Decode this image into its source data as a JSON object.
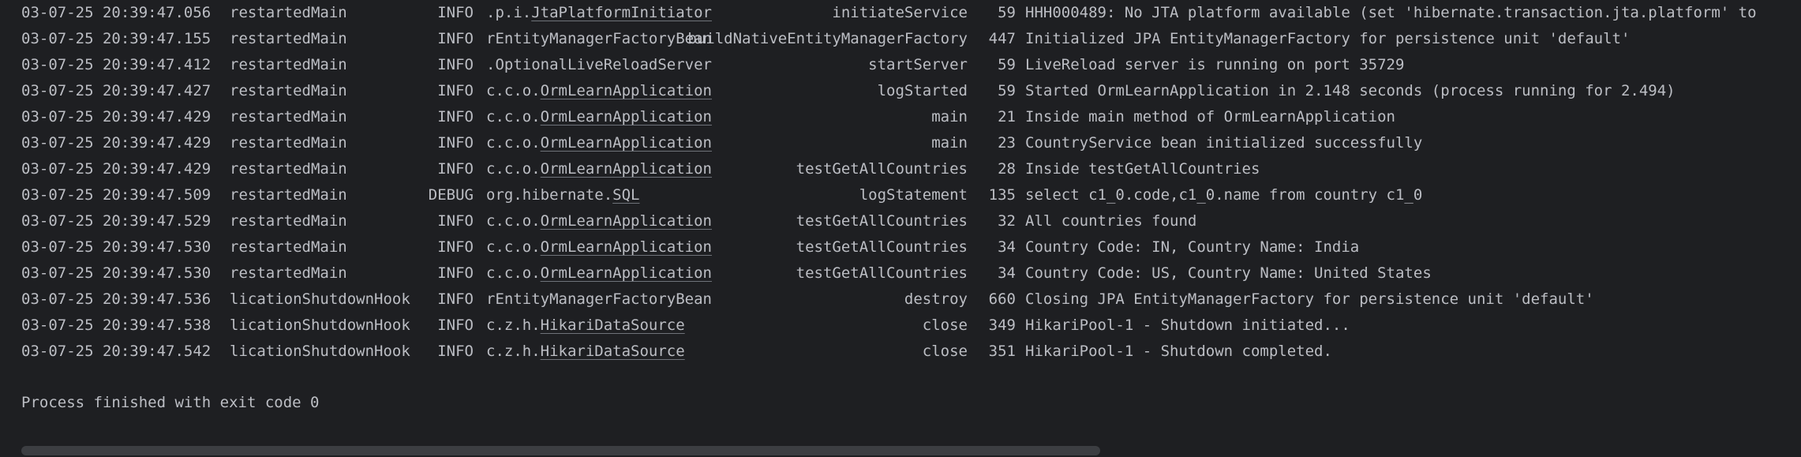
{
  "console": {
    "rows": [
      {
        "ts": "03-07-25 20:39:47.056",
        "thread": "restartedMain",
        "level": "INFO",
        "logger_prefix": ".p.i.",
        "logger_link": "JtaPlatformInitiator",
        "method": "initiateService",
        "line": "59",
        "message": "HHH000489: No JTA platform available (set 'hibernate.transaction.jta.platform' to"
      },
      {
        "ts": "03-07-25 20:39:47.155",
        "thread": "restartedMain",
        "level": "INFO",
        "logger_prefix": "rEntityManagerFactoryBean",
        "logger_link": "",
        "method": "buildNativeEntityManagerFactory",
        "line": "447",
        "message": "Initialized JPA EntityManagerFactory for persistence unit 'default'"
      },
      {
        "ts": "03-07-25 20:39:47.412",
        "thread": "restartedMain",
        "level": "INFO",
        "logger_prefix": ".OptionalLiveReloadServer",
        "logger_link": "",
        "method": "startServer",
        "line": "59",
        "message": "LiveReload server is running on port 35729"
      },
      {
        "ts": "03-07-25 20:39:47.427",
        "thread": "restartedMain",
        "level": "INFO",
        "logger_prefix": "c.c.o.",
        "logger_link": "OrmLearnApplication",
        "method": "logStarted",
        "line": "59",
        "message": "Started OrmLearnApplication in 2.148 seconds (process running for 2.494)"
      },
      {
        "ts": "03-07-25 20:39:47.429",
        "thread": "restartedMain",
        "level": "INFO",
        "logger_prefix": "c.c.o.",
        "logger_link": "OrmLearnApplication",
        "method": "main",
        "line": "21",
        "message": "Inside main method of OrmLearnApplication"
      },
      {
        "ts": "03-07-25 20:39:47.429",
        "thread": "restartedMain",
        "level": "INFO",
        "logger_prefix": "c.c.o.",
        "logger_link": "OrmLearnApplication",
        "method": "main",
        "line": "23",
        "message": "CountryService bean initialized successfully"
      },
      {
        "ts": "03-07-25 20:39:47.429",
        "thread": "restartedMain",
        "level": "INFO",
        "logger_prefix": "c.c.o.",
        "logger_link": "OrmLearnApplication",
        "method": "testGetAllCountries",
        "line": "28",
        "message": "Inside testGetAllCountries"
      },
      {
        "ts": "03-07-25 20:39:47.509",
        "thread": "restartedMain",
        "level": "DEBUG",
        "logger_prefix": "org.hibernate.",
        "logger_link": "SQL",
        "method": "logStatement",
        "line": "135",
        "message": "select c1_0.code,c1_0.name from country c1_0"
      },
      {
        "ts": "03-07-25 20:39:47.529",
        "thread": "restartedMain",
        "level": "INFO",
        "logger_prefix": "c.c.o.",
        "logger_link": "OrmLearnApplication",
        "method": "testGetAllCountries",
        "line": "32",
        "message": "All countries found"
      },
      {
        "ts": "03-07-25 20:39:47.530",
        "thread": "restartedMain",
        "level": "INFO",
        "logger_prefix": "c.c.o.",
        "logger_link": "OrmLearnApplication",
        "method": "testGetAllCountries",
        "line": "34",
        "message": "Country Code: IN, Country Name: India"
      },
      {
        "ts": "03-07-25 20:39:47.530",
        "thread": "restartedMain",
        "level": "INFO",
        "logger_prefix": "c.c.o.",
        "logger_link": "OrmLearnApplication",
        "method": "testGetAllCountries",
        "line": "34",
        "message": "Country Code: US, Country Name: United States"
      },
      {
        "ts": "03-07-25 20:39:47.536",
        "thread": "licationShutdownHook",
        "level": "INFO",
        "logger_prefix": "rEntityManagerFactoryBean",
        "logger_link": "",
        "method": "destroy",
        "line": "660",
        "message": "Closing JPA EntityManagerFactory for persistence unit 'default'"
      },
      {
        "ts": "03-07-25 20:39:47.538",
        "thread": "licationShutdownHook",
        "level": "INFO",
        "logger_prefix": "c.z.h.",
        "logger_link": "HikariDataSource",
        "method": "close",
        "line": "349",
        "message": "HikariPool-1 - Shutdown initiated..."
      },
      {
        "ts": "03-07-25 20:39:47.542",
        "thread": "licationShutdownHook",
        "level": "INFO",
        "logger_prefix": "c.z.h.",
        "logger_link": "HikariDataSource",
        "method": "close",
        "line": "351",
        "message": "HikariPool-1 - Shutdown completed."
      }
    ],
    "exit_message": "Process finished with exit code 0"
  },
  "colors": {
    "background": "#1e1f22",
    "text": "#bcbec4",
    "scroll_thumb": "#3c3e42"
  }
}
